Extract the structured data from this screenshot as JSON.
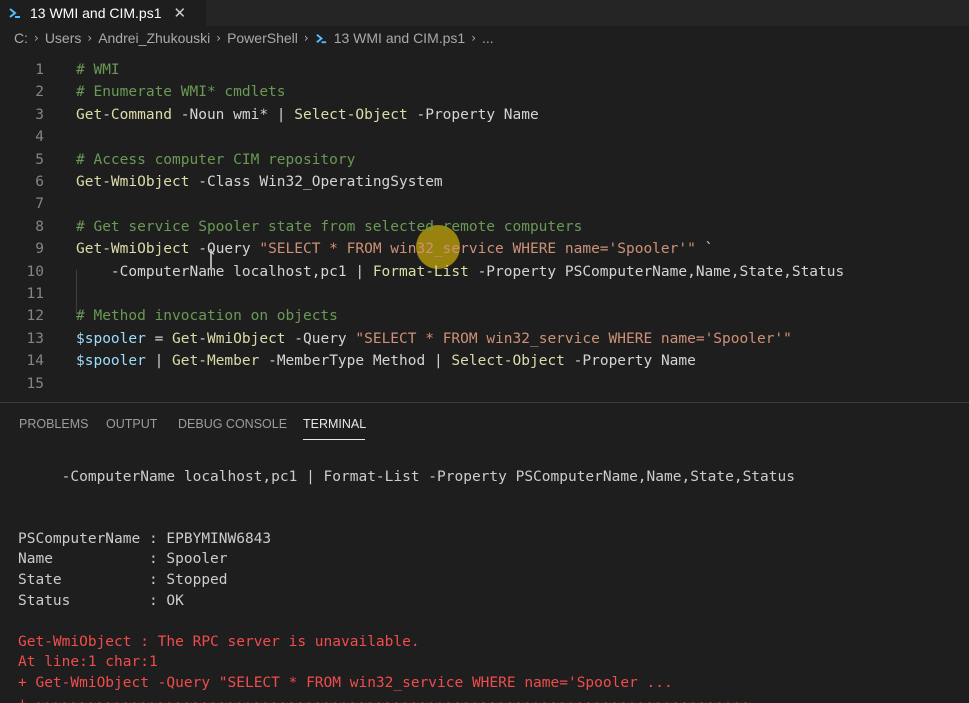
{
  "tab": {
    "label": "13 WMI and CIM.ps1",
    "close": "✕",
    "icon": "powershell-icon"
  },
  "breadcrumb": {
    "items": [
      "C:",
      "Users",
      "Andrei_Zhukouski",
      "PowerShell",
      "13 WMI and CIM.ps1",
      "..."
    ],
    "separator": "›"
  },
  "editor": {
    "line_numbers": [
      "1",
      "2",
      "3",
      "4",
      "5",
      "6",
      "7",
      "8",
      "9",
      "10",
      "11",
      "12",
      "13",
      "14",
      "15"
    ],
    "lines": [
      [
        {
          "t": "# WMI",
          "k": "comment"
        }
      ],
      [
        {
          "t": "# Enumerate WMI* cmdlets",
          "k": "comment"
        }
      ],
      [
        {
          "t": "Get-Command",
          "k": "cmd"
        },
        {
          "t": " -Noun wmi* | ",
          "k": "plain"
        },
        {
          "t": "Select-Object",
          "k": "cmd"
        },
        {
          "t": " -Property Name",
          "k": "plain"
        }
      ],
      [],
      [
        {
          "t": "# Access computer CIM repository",
          "k": "comment"
        }
      ],
      [
        {
          "t": "Get-WmiObject",
          "k": "cmd"
        },
        {
          "t": " -Class Win32_OperatingSystem",
          "k": "plain"
        }
      ],
      [],
      [
        {
          "t": "# Get service Spooler state from selected remote computers",
          "k": "comment"
        }
      ],
      [
        {
          "t": "Get-WmiObject",
          "k": "cmd"
        },
        {
          "t": " -Query ",
          "k": "plain"
        },
        {
          "t": "\"SELECT * FROM win32_service WHERE name='Spooler'\"",
          "k": "str"
        },
        {
          "t": " `",
          "k": "plain"
        }
      ],
      [
        {
          "t": "    -ComputerName localhost,pc1 | ",
          "k": "plain"
        },
        {
          "t": "Format-List",
          "k": "cmd"
        },
        {
          "t": " -Property PSComputerName,Name,State,Status",
          "k": "plain"
        }
      ],
      [],
      [
        {
          "t": "# Method invocation on objects",
          "k": "comment"
        }
      ],
      [
        {
          "t": "$spooler",
          "k": "var"
        },
        {
          "t": " = ",
          "k": "plain"
        },
        {
          "t": "Get-WmiObject",
          "k": "cmd"
        },
        {
          "t": " -Query ",
          "k": "plain"
        },
        {
          "t": "\"SELECT * FROM win32_service WHERE name='Spooler'\"",
          "k": "str"
        }
      ],
      [
        {
          "t": "$spooler",
          "k": "var"
        },
        {
          "t": " | ",
          "k": "plain"
        },
        {
          "t": "Get-Member",
          "k": "cmd"
        },
        {
          "t": " -MemberType Method | ",
          "k": "plain"
        },
        {
          "t": "Select-Object",
          "k": "cmd"
        },
        {
          "t": " -Property Name",
          "k": "plain"
        }
      ],
      []
    ]
  },
  "panel": {
    "tabs": [
      "PROBLEMS",
      "OUTPUT",
      "DEBUG CONSOLE",
      "TERMINAL"
    ],
    "active_tab": "TERMINAL"
  },
  "terminal": {
    "lines": [
      {
        "text": "     -ComputerName localhost,pc1 | Format-List -Property PSComputerName,Name,State,Status",
        "kind": "normal"
      },
      {
        "text": "",
        "kind": "normal"
      },
      {
        "text": "",
        "kind": "normal"
      },
      {
        "text": "PSComputerName : EPBYMINW6843",
        "kind": "normal"
      },
      {
        "text": "Name           : Spooler",
        "kind": "normal"
      },
      {
        "text": "State          : Stopped",
        "kind": "normal"
      },
      {
        "text": "Status         : OK",
        "kind": "normal"
      },
      {
        "text": "",
        "kind": "normal"
      },
      {
        "text": "Get-WmiObject : The RPC server is unavailable.",
        "kind": "err"
      },
      {
        "text": "At line:1 char:1",
        "kind": "err"
      },
      {
        "text": "+ Get-WmiObject -Query \"SELECT * FROM win32_service WHERE name='Spooler ...",
        "kind": "err"
      },
      {
        "text": "+ ~~~~~~~~~~~~~~~~~~~~~~~~~~~~~~~~~~~~~~~~~~~~~~~~~~~~~~~~~~~~~~~~~~~~~~~~~~~~~~~~~~",
        "kind": "err"
      }
    ]
  },
  "colors": {
    "background": "#1e1e1e",
    "comment": "#6a9955",
    "cmdlet": "#dcdcaa",
    "string": "#ce9178",
    "variable": "#9cdcfe",
    "error": "#f14c4c",
    "powershell_icon": "#4fc1ff"
  }
}
